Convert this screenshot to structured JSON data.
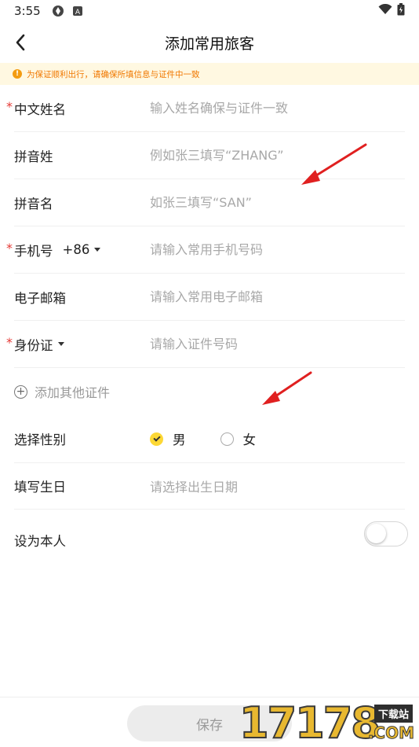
{
  "status_bar": {
    "time": "3:55"
  },
  "nav": {
    "title": "添加常用旅客"
  },
  "notice": {
    "text": "为保证顺利出行，请确保所填信息与证件中一致"
  },
  "form": {
    "chinese_name": {
      "label": "中文姓名",
      "placeholder": "输入姓名确保与证件一致"
    },
    "pinyin_surname": {
      "label": "拼音姓",
      "placeholder": "例如张三填写“ZHANG”"
    },
    "pinyin_given": {
      "label": "拼音名",
      "placeholder": "如张三填写“SAN”"
    },
    "phone": {
      "label": "手机号",
      "country_code": "+86",
      "placeholder": "请输入常用手机号码"
    },
    "email": {
      "label": "电子邮箱",
      "placeholder": "请输入常用电子邮箱"
    },
    "id_type": {
      "label": "身份证",
      "placeholder": "请输入证件号码"
    },
    "add_document": "添加其他证件",
    "gender": {
      "label": "选择性别",
      "male": "男",
      "female": "女",
      "selected": "男"
    },
    "birthday": {
      "label": "填写生日",
      "placeholder": "请选择出生日期"
    },
    "set_as_self": {
      "label": "设为本人",
      "on": false
    }
  },
  "footer": {
    "save_label": "保存"
  },
  "watermark": {
    "digits": "17178",
    "tag": "下载站",
    "com": ".COM"
  },
  "colors": {
    "accent": "#fdd835",
    "required": "#e53935",
    "notice_text": "#f07800",
    "notice_bg": "#fff8e1"
  }
}
